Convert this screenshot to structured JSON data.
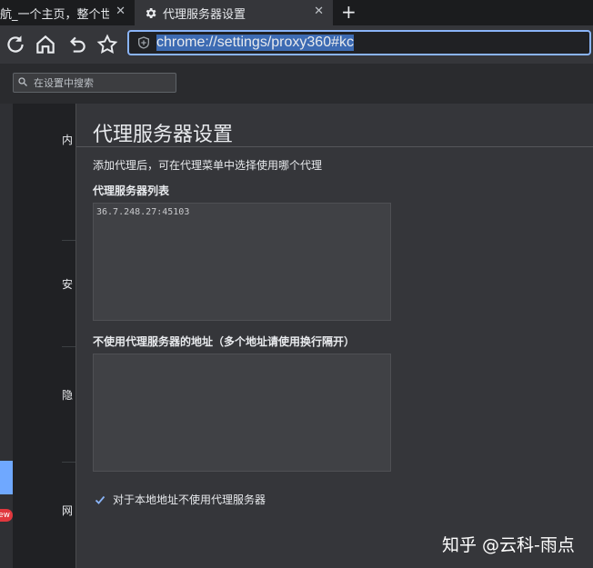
{
  "tabs": [
    {
      "title": "航_一个主页，整个世界",
      "close": "✕"
    },
    {
      "title": "代理服务器设置",
      "close": "✕"
    }
  ],
  "new_tab": "+",
  "omnibox": {
    "url": "chrome://settings/proxy360#kc"
  },
  "settings_search": {
    "placeholder": "在设置中搜索"
  },
  "background_items": [
    "内",
    "安",
    "隐",
    "网"
  ],
  "sidebar_badge": "ew",
  "dialog": {
    "title": "代理服务器设置",
    "description": "添加代理后，可在代理菜单中选择使用哪个代理",
    "proxy_list_label": "代理服务器列表",
    "proxy_list_value": "36.7.248.27:45103",
    "bypass_label": "不使用代理服务器的地址（多个地址请使用换行隔开）",
    "bypass_value": "",
    "local_bypass_label": "对于本地地址不使用代理服务器",
    "local_bypass_checked": true
  },
  "watermark": "知乎 @云科-雨点",
  "colors": {
    "accent": "#8ab4f8",
    "checkbox": "#8ab4f8",
    "badge": "#e0383e"
  }
}
